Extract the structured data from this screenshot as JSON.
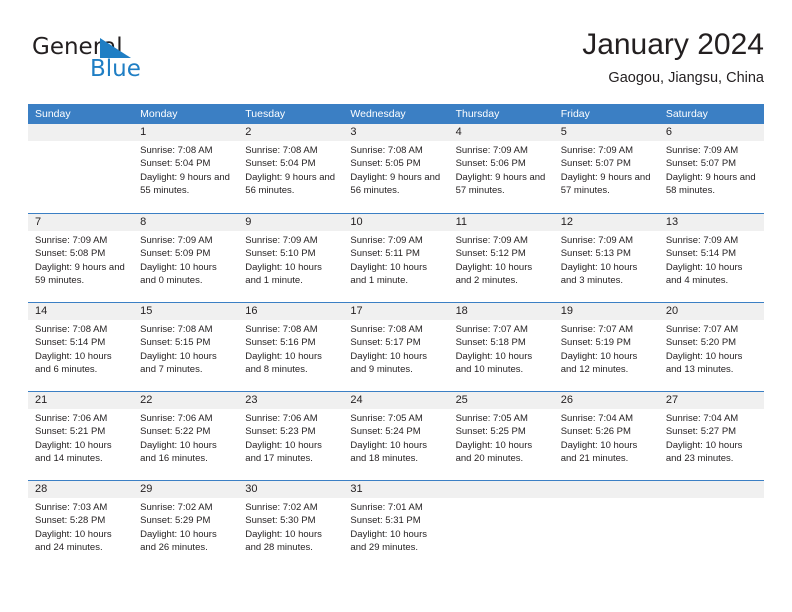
{
  "logo": {
    "general_text": "General",
    "blue_text": "Blue",
    "accent_color": "#1f7ec4"
  },
  "header": {
    "title": "January 2024",
    "subtitle": "Gaogou, Jiangsu, China"
  },
  "theme": {
    "header_blue": "#3b7fc4",
    "daynum_bg": "#f0f0f0",
    "text": "#231f20"
  },
  "weekdays": [
    "Sunday",
    "Monday",
    "Tuesday",
    "Wednesday",
    "Thursday",
    "Friday",
    "Saturday"
  ],
  "weeks": [
    [
      {
        "day": "",
        "sunrise": "",
        "sunset": "",
        "daylight": ""
      },
      {
        "day": "1",
        "sunrise": "Sunrise: 7:08 AM",
        "sunset": "Sunset: 5:04 PM",
        "daylight": "Daylight: 9 hours and 55 minutes."
      },
      {
        "day": "2",
        "sunrise": "Sunrise: 7:08 AM",
        "sunset": "Sunset: 5:04 PM",
        "daylight": "Daylight: 9 hours and 56 minutes."
      },
      {
        "day": "3",
        "sunrise": "Sunrise: 7:08 AM",
        "sunset": "Sunset: 5:05 PM",
        "daylight": "Daylight: 9 hours and 56 minutes."
      },
      {
        "day": "4",
        "sunrise": "Sunrise: 7:09 AM",
        "sunset": "Sunset: 5:06 PM",
        "daylight": "Daylight: 9 hours and 57 minutes."
      },
      {
        "day": "5",
        "sunrise": "Sunrise: 7:09 AM",
        "sunset": "Sunset: 5:07 PM",
        "daylight": "Daylight: 9 hours and 57 minutes."
      },
      {
        "day": "6",
        "sunrise": "Sunrise: 7:09 AM",
        "sunset": "Sunset: 5:07 PM",
        "daylight": "Daylight: 9 hours and 58 minutes."
      }
    ],
    [
      {
        "day": "7",
        "sunrise": "Sunrise: 7:09 AM",
        "sunset": "Sunset: 5:08 PM",
        "daylight": "Daylight: 9 hours and 59 minutes."
      },
      {
        "day": "8",
        "sunrise": "Sunrise: 7:09 AM",
        "sunset": "Sunset: 5:09 PM",
        "daylight": "Daylight: 10 hours and 0 minutes."
      },
      {
        "day": "9",
        "sunrise": "Sunrise: 7:09 AM",
        "sunset": "Sunset: 5:10 PM",
        "daylight": "Daylight: 10 hours and 1 minute."
      },
      {
        "day": "10",
        "sunrise": "Sunrise: 7:09 AM",
        "sunset": "Sunset: 5:11 PM",
        "daylight": "Daylight: 10 hours and 1 minute."
      },
      {
        "day": "11",
        "sunrise": "Sunrise: 7:09 AM",
        "sunset": "Sunset: 5:12 PM",
        "daylight": "Daylight: 10 hours and 2 minutes."
      },
      {
        "day": "12",
        "sunrise": "Sunrise: 7:09 AM",
        "sunset": "Sunset: 5:13 PM",
        "daylight": "Daylight: 10 hours and 3 minutes."
      },
      {
        "day": "13",
        "sunrise": "Sunrise: 7:09 AM",
        "sunset": "Sunset: 5:14 PM",
        "daylight": "Daylight: 10 hours and 4 minutes."
      }
    ],
    [
      {
        "day": "14",
        "sunrise": "Sunrise: 7:08 AM",
        "sunset": "Sunset: 5:14 PM",
        "daylight": "Daylight: 10 hours and 6 minutes."
      },
      {
        "day": "15",
        "sunrise": "Sunrise: 7:08 AM",
        "sunset": "Sunset: 5:15 PM",
        "daylight": "Daylight: 10 hours and 7 minutes."
      },
      {
        "day": "16",
        "sunrise": "Sunrise: 7:08 AM",
        "sunset": "Sunset: 5:16 PM",
        "daylight": "Daylight: 10 hours and 8 minutes."
      },
      {
        "day": "17",
        "sunrise": "Sunrise: 7:08 AM",
        "sunset": "Sunset: 5:17 PM",
        "daylight": "Daylight: 10 hours and 9 minutes."
      },
      {
        "day": "18",
        "sunrise": "Sunrise: 7:07 AM",
        "sunset": "Sunset: 5:18 PM",
        "daylight": "Daylight: 10 hours and 10 minutes."
      },
      {
        "day": "19",
        "sunrise": "Sunrise: 7:07 AM",
        "sunset": "Sunset: 5:19 PM",
        "daylight": "Daylight: 10 hours and 12 minutes."
      },
      {
        "day": "20",
        "sunrise": "Sunrise: 7:07 AM",
        "sunset": "Sunset: 5:20 PM",
        "daylight": "Daylight: 10 hours and 13 minutes."
      }
    ],
    [
      {
        "day": "21",
        "sunrise": "Sunrise: 7:06 AM",
        "sunset": "Sunset: 5:21 PM",
        "daylight": "Daylight: 10 hours and 14 minutes."
      },
      {
        "day": "22",
        "sunrise": "Sunrise: 7:06 AM",
        "sunset": "Sunset: 5:22 PM",
        "daylight": "Daylight: 10 hours and 16 minutes."
      },
      {
        "day": "23",
        "sunrise": "Sunrise: 7:06 AM",
        "sunset": "Sunset: 5:23 PM",
        "daylight": "Daylight: 10 hours and 17 minutes."
      },
      {
        "day": "24",
        "sunrise": "Sunrise: 7:05 AM",
        "sunset": "Sunset: 5:24 PM",
        "daylight": "Daylight: 10 hours and 18 minutes."
      },
      {
        "day": "25",
        "sunrise": "Sunrise: 7:05 AM",
        "sunset": "Sunset: 5:25 PM",
        "daylight": "Daylight: 10 hours and 20 minutes."
      },
      {
        "day": "26",
        "sunrise": "Sunrise: 7:04 AM",
        "sunset": "Sunset: 5:26 PM",
        "daylight": "Daylight: 10 hours and 21 minutes."
      },
      {
        "day": "27",
        "sunrise": "Sunrise: 7:04 AM",
        "sunset": "Sunset: 5:27 PM",
        "daylight": "Daylight: 10 hours and 23 minutes."
      }
    ],
    [
      {
        "day": "28",
        "sunrise": "Sunrise: 7:03 AM",
        "sunset": "Sunset: 5:28 PM",
        "daylight": "Daylight: 10 hours and 24 minutes."
      },
      {
        "day": "29",
        "sunrise": "Sunrise: 7:02 AM",
        "sunset": "Sunset: 5:29 PM",
        "daylight": "Daylight: 10 hours and 26 minutes."
      },
      {
        "day": "30",
        "sunrise": "Sunrise: 7:02 AM",
        "sunset": "Sunset: 5:30 PM",
        "daylight": "Daylight: 10 hours and 28 minutes."
      },
      {
        "day": "31",
        "sunrise": "Sunrise: 7:01 AM",
        "sunset": "Sunset: 5:31 PM",
        "daylight": "Daylight: 10 hours and 29 minutes."
      },
      {
        "day": "",
        "sunrise": "",
        "sunset": "",
        "daylight": ""
      },
      {
        "day": "",
        "sunrise": "",
        "sunset": "",
        "daylight": ""
      },
      {
        "day": "",
        "sunrise": "",
        "sunset": "",
        "daylight": ""
      }
    ]
  ]
}
